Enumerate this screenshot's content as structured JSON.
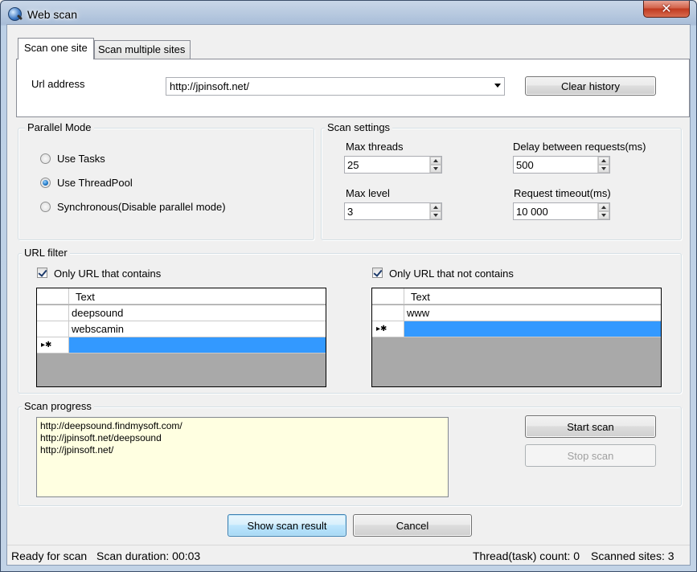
{
  "window": {
    "title": "Web scan",
    "close_glyph": "✕",
    "icon": "globe-search-icon"
  },
  "tabs": [
    {
      "label": "Scan one site",
      "active": true
    },
    {
      "label": "Scan multiple sites",
      "active": false
    }
  ],
  "url_panel": {
    "url_label": "Url address",
    "url_value": "http://jpinsoft.net/",
    "clear_history_label": "Clear history"
  },
  "parallel_mode": {
    "title": "Parallel Mode",
    "options": [
      {
        "label": "Use Tasks",
        "checked": false
      },
      {
        "label": "Use ThreadPool",
        "checked": true
      },
      {
        "label": "Synchronous(Disable parallel mode)",
        "checked": false
      }
    ]
  },
  "scan_settings": {
    "title": "Scan settings",
    "max_threads_label": "Max threads",
    "max_threads_value": "25",
    "delay_label": "Delay between requests(ms)",
    "delay_value": "500",
    "max_level_label": "Max level",
    "max_level_value": "3",
    "timeout_label": "Request timeout(ms)",
    "timeout_value": "10 000"
  },
  "url_filter": {
    "title": "URL filter",
    "contains": {
      "label": "Only URL that contains",
      "checked": true,
      "column": "Text",
      "rows": [
        "deepsound",
        "webscamin"
      ],
      "new_row_marker": "▸✱"
    },
    "not_contains": {
      "label": "Only URL that not contains",
      "checked": true,
      "column": "Text",
      "rows": [
        "www"
      ],
      "new_row_marker": "▸✱"
    }
  },
  "scan_progress": {
    "title": "Scan progress",
    "log": [
      "http://deepsound.findmysoft.com/",
      "http://jpinsoft.net/deepsound",
      "http://jpinsoft.net/"
    ],
    "start_label": "Start scan",
    "stop_label": "Stop scan"
  },
  "actions": {
    "show_result_label": "Show scan result",
    "cancel_label": "Cancel"
  },
  "status": {
    "state": "Ready for scan",
    "duration": "Scan duration: 00:03",
    "thread_count": "Thread(task) count: 0",
    "scanned_sites": "Scanned sites: 3"
  }
}
